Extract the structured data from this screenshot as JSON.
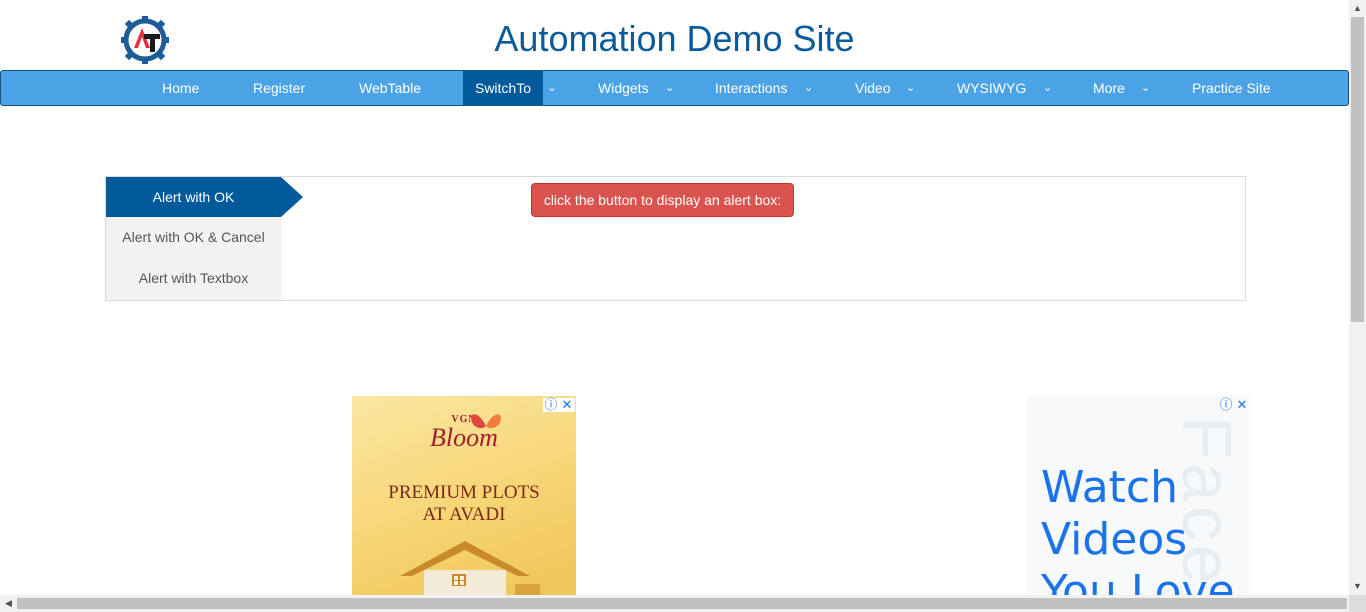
{
  "site": {
    "title": "Automation Demo Site",
    "logo_icon": "gear-logo-icon"
  },
  "nav": {
    "items": [
      {
        "label": "Home",
        "dropdown": false
      },
      {
        "label": "Register",
        "dropdown": false
      },
      {
        "label": "WebTable",
        "dropdown": false
      },
      {
        "label": "SwitchTo",
        "dropdown": true,
        "active": true
      },
      {
        "label": "Widgets",
        "dropdown": true
      },
      {
        "label": "Interactions",
        "dropdown": true
      },
      {
        "label": "Video",
        "dropdown": true
      },
      {
        "label": "WYSIWYG",
        "dropdown": true
      },
      {
        "label": "More",
        "dropdown": true
      },
      {
        "label": "Practice Site",
        "dropdown": false
      }
    ],
    "chevron": "⌄"
  },
  "tabs": [
    {
      "label": "Alert with OK",
      "active": true
    },
    {
      "label": "Alert with OK & Cancel"
    },
    {
      "label": "Alert with Textbox"
    }
  ],
  "alert_button_label": "click the button to display an alert box:",
  "ads": {
    "left": {
      "brand_top": "VGN",
      "brand_name": "Bloom",
      "headline_1": "PREMIUM PLOTS",
      "headline_2": "AT AVADI",
      "info_icon": "ⓘ",
      "close_icon": "✕"
    },
    "right": {
      "watermark": "Face",
      "line_1": "Watch",
      "line_2": "Videos",
      "line_3": "You Love",
      "info_icon": "ⓘ",
      "close_icon": "✕"
    }
  },
  "colors": {
    "nav_bg": "#4ba3e6",
    "nav_active": "#005a9c",
    "title": "#0a5a9c",
    "alert_button": "#d9534f"
  }
}
